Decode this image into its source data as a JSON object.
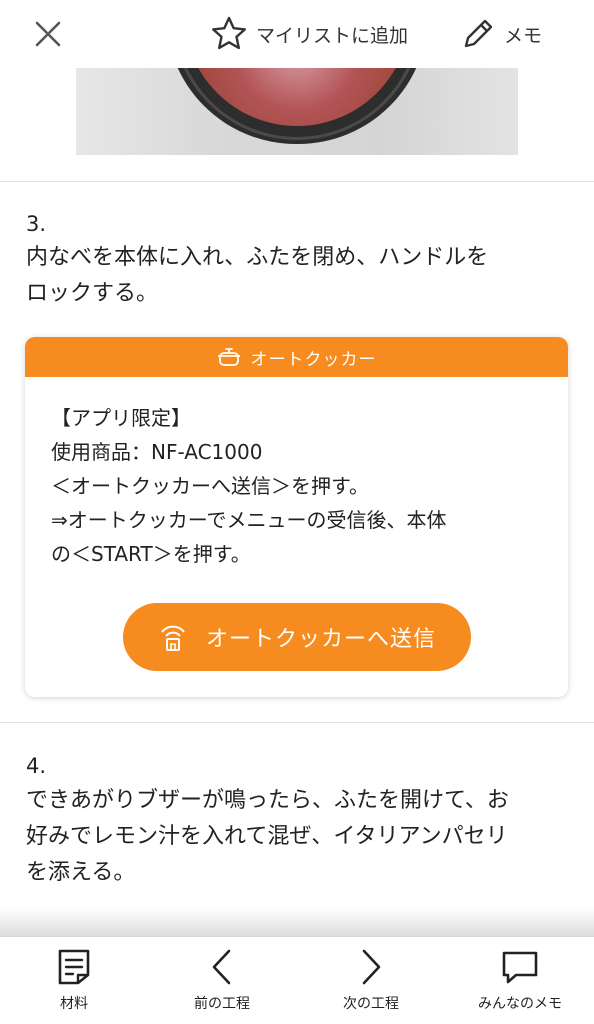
{
  "header": {
    "mylist_label": "マイリストに追加",
    "memo_label": "メモ"
  },
  "steps": [
    {
      "number": "3.",
      "lines": [
        "内なべを本体に入れ、ふたを閉め、ハンドルを",
        "ロックする。"
      ]
    },
    {
      "number": "4.",
      "lines": [
        "できあがりブザーが鳴ったら、ふたを開けて、お",
        "好みでレモン汁を入れて混ぜ、イタリアンパセリ",
        "を添える。"
      ]
    }
  ],
  "cooker_card": {
    "header_label": "オートクッカー",
    "lines": [
      "【アプリ限定】",
      "使用商品：NF-AC1000",
      "＜オートクッカーへ送信＞を押す。",
      "⇒オートクッカーでメニューの受信後、本体",
      "の＜START＞を押す。"
    ],
    "send_button_label": "オートクッカーへ送信"
  },
  "bottom_nav": {
    "items": [
      {
        "label": "材料",
        "icon": "ingredients-icon"
      },
      {
        "label": "前の工程",
        "icon": "chevron-left-icon"
      },
      {
        "label": "次の工程",
        "icon": "chevron-right-icon"
      },
      {
        "label": "みんなのメモ",
        "icon": "speech-bubble-icon"
      }
    ]
  },
  "colors": {
    "accent": "#f68b1f",
    "text": "#222222",
    "divider": "#e2e2e2"
  }
}
